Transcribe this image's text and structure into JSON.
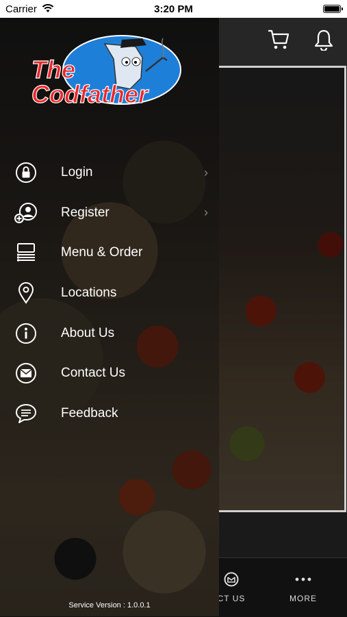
{
  "status_bar": {
    "carrier": "Carrier",
    "time": "3:20 PM"
  },
  "topbar": {
    "cart_icon": "cart-icon",
    "bell_icon": "bell-icon"
  },
  "bottom_nav": {
    "items": [
      {
        "label": "CT US",
        "icon": "envelope-icon"
      },
      {
        "label": "MORE",
        "icon": "more-icon"
      }
    ]
  },
  "drawer": {
    "logo": {
      "line1": "The",
      "line2": "Codfather"
    },
    "menu": [
      {
        "label": "Login",
        "icon": "lock-icon",
        "has_chevron": true
      },
      {
        "label": "Register",
        "icon": "add-user-icon",
        "has_chevron": true
      },
      {
        "label": "Menu & Order",
        "icon": "menu-list-icon",
        "has_chevron": false
      },
      {
        "label": "Locations",
        "icon": "location-pin-icon",
        "has_chevron": false
      },
      {
        "label": "About Us",
        "icon": "info-icon",
        "has_chevron": false
      },
      {
        "label": "Contact Us",
        "icon": "envelope-icon",
        "has_chevron": false
      },
      {
        "label": "Feedback",
        "icon": "chat-bubble-icon",
        "has_chevron": false
      }
    ],
    "version": "Service Version : 1.0.0.1"
  },
  "colors": {
    "logo_red": "#e8282a",
    "logo_blue": "#1e7fd8",
    "text": "#ffffff"
  }
}
